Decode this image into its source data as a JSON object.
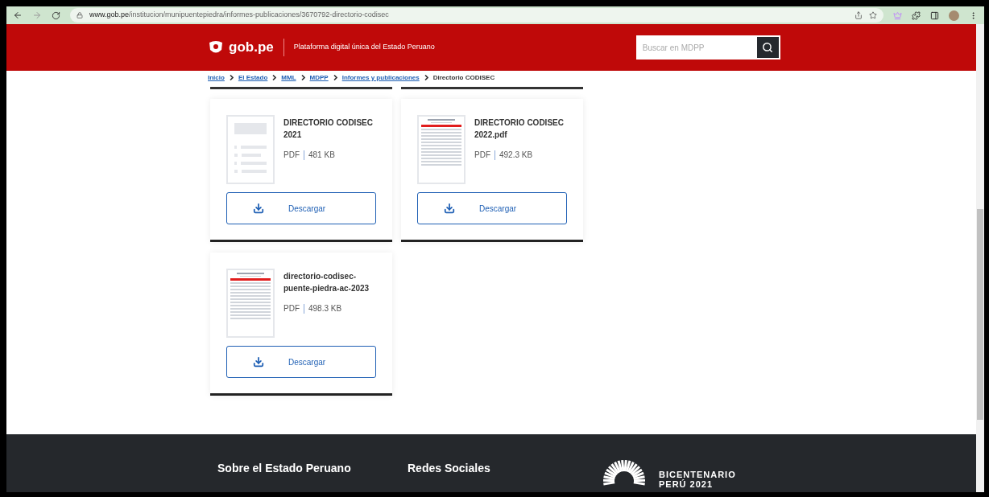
{
  "browser": {
    "url_host": "www.gob.pe",
    "url_path": "/institucion/munipuentepiedra/informes-publicaciones/3670792-directorio-codisec"
  },
  "header": {
    "logo": "gob.pe",
    "tagline": "Plataforma digital única del Estado Peruano",
    "search": {
      "placeholder": "Buscar en MDPP"
    }
  },
  "breadcrumb": [
    {
      "label": "Inicio",
      "link": true
    },
    {
      "label": "El Estado",
      "link": true
    },
    {
      "label": "MML",
      "link": true
    },
    {
      "label": "MDPP",
      "link": true
    },
    {
      "label": "Informes y publicaciones",
      "link": true
    },
    {
      "label": "Directorio CODISEC",
      "link": false
    }
  ],
  "documents": [
    {
      "title": "DIRECTORIO CODISEC 2021",
      "format": "PDF",
      "size": "481 KB",
      "kind": "generic",
      "button": "Descargar"
    },
    {
      "title": "DIRECTORIO CODISEC 2022.pdf",
      "format": "PDF",
      "size": "492.3 KB",
      "kind": "preview",
      "button": "Descargar"
    },
    {
      "title": "directorio-codisec-puente-piedra-ac-2023",
      "format": "PDF",
      "size": "498.3 KB",
      "kind": "preview",
      "button": "Descargar"
    }
  ],
  "footer": {
    "columns": [
      "Sobre el Estado Peruano",
      "Redes Sociales"
    ],
    "badge": [
      "BICENTENARIO",
      "PERÚ 2021"
    ]
  }
}
